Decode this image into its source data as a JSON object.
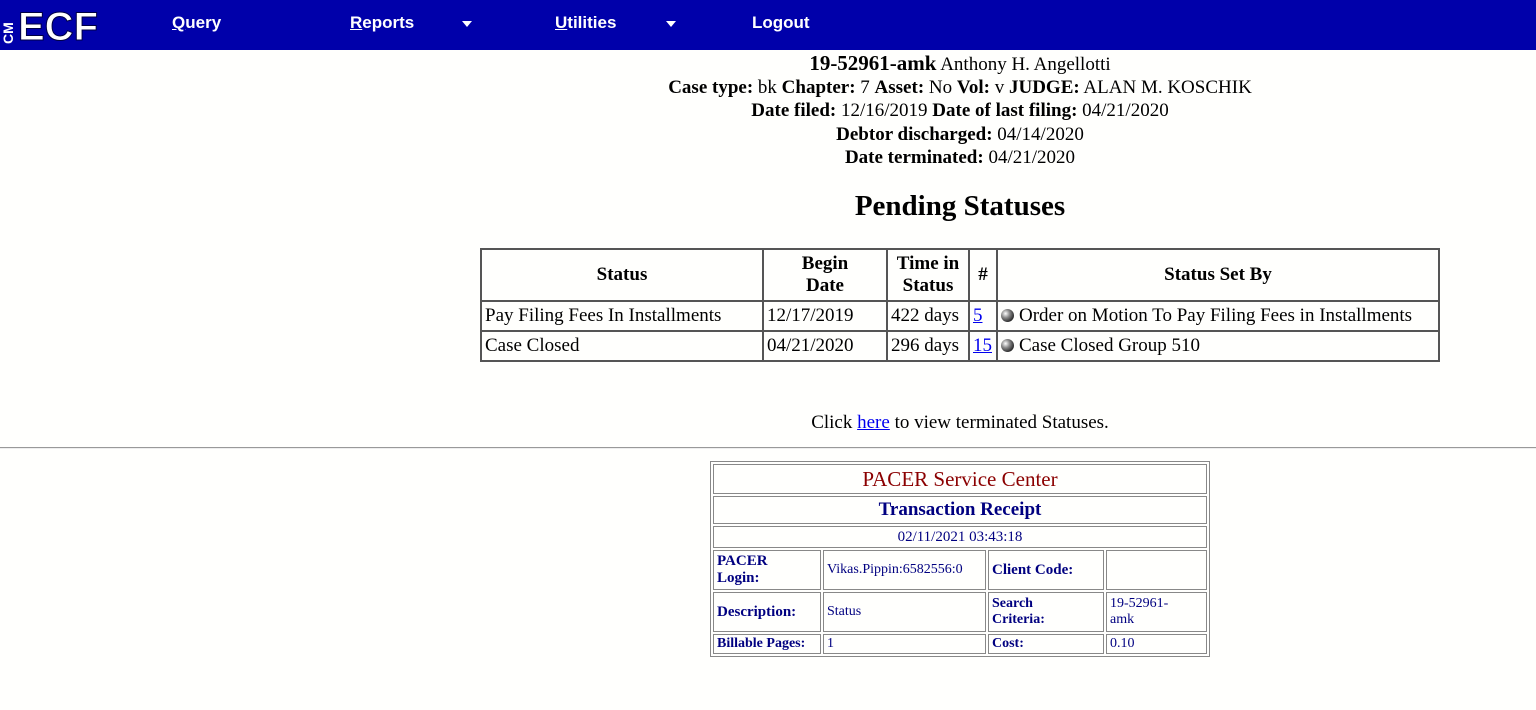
{
  "nav": {
    "logo_text": "ECF",
    "logo_side_text": "CM",
    "query": "Query",
    "reports": "Reports",
    "utilities": "Utilities",
    "logout": "Logout"
  },
  "case": {
    "number": "19-52961-amk",
    "debtor": "Anthony H. Angellotti",
    "case_type_label": "Case type:",
    "case_type": "bk",
    "chapter_label": "Chapter:",
    "chapter": "7",
    "asset_label": "Asset:",
    "asset": "No",
    "vol_label": "Vol:",
    "vol": "v",
    "judge_label": "JUDGE:",
    "judge": "ALAN M. KOSCHIK",
    "date_filed_label": "Date filed:",
    "date_filed": "12/16/2019",
    "last_filing_label": "Date of last filing:",
    "last_filing": "04/21/2020",
    "discharged_label": "Debtor discharged:",
    "discharged": "04/14/2020",
    "terminated_label": "Date terminated:",
    "terminated": "04/21/2020"
  },
  "pending": {
    "title": "Pending Statuses",
    "headers": {
      "status": "Status",
      "begin_date_1": "Begin",
      "begin_date_2": "Date",
      "time_1": "Time in",
      "time_2": "Status",
      "num": "#",
      "set_by": "Status Set By"
    },
    "rows": [
      {
        "status": "Pay Filing Fees In Installments",
        "begin": "12/17/2019",
        "time": "422 days",
        "num": "5",
        "set_by": "Order on Motion To Pay Filing Fees in Installments"
      },
      {
        "status": "Case Closed",
        "begin": "04/21/2020",
        "time": "296 days",
        "num": "15",
        "set_by": "Case Closed Group 510"
      }
    ]
  },
  "terminated_link": {
    "prefix": "Click",
    "link": "here",
    "suffix": "to view terminated Statuses."
  },
  "receipt": {
    "title": "PACER Service Center",
    "subtitle": "Transaction Receipt",
    "datetime": "02/11/2021 03:43:18",
    "login_label_1": "PACER",
    "login_label_2": "Login:",
    "login": "Vikas.Pippin:6582556:0",
    "client_code_label": "Client Code:",
    "client_code": "",
    "description_label": "Description:",
    "description": "Status",
    "search_label_1": "Search",
    "search_label_2": "Criteria:",
    "search_1": "19-52961-",
    "search_2": "amk",
    "billable_label": "Billable Pages:",
    "billable": "1",
    "cost_label": "Cost:",
    "cost": "0.10"
  },
  "colors": {
    "navbar": "#0000aa",
    "receipt_text": "#000080",
    "receipt_title": "#8b0000",
    "link": "#0000ee"
  }
}
